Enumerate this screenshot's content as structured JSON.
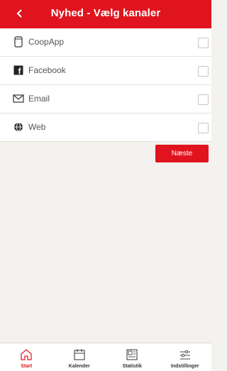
{
  "header": {
    "title": "Nyhed - Vælg kanaler",
    "back_icon": "chevron-left-icon"
  },
  "channels": [
    {
      "label": "CoopApp",
      "icon": "phone-icon",
      "checked": false
    },
    {
      "label": "Facebook",
      "icon": "facebook-icon",
      "checked": false
    },
    {
      "label": "Email",
      "icon": "envelope-icon",
      "checked": false
    },
    {
      "label": "Web",
      "icon": "globe-icon",
      "checked": false
    }
  ],
  "next_button": {
    "label": "Næste"
  },
  "tabbar": {
    "active": "Start",
    "tabs": [
      {
        "label": "Start",
        "icon": "home-icon"
      },
      {
        "label": "Kalender",
        "icon": "calendar-icon"
      },
      {
        "label": "Statistik",
        "icon": "statistics-icon"
      },
      {
        "label": "Indstillinger",
        "icon": "sliders-icon"
      }
    ]
  },
  "colors": {
    "accent": "#e0141e",
    "background": "#f4f2ee"
  }
}
